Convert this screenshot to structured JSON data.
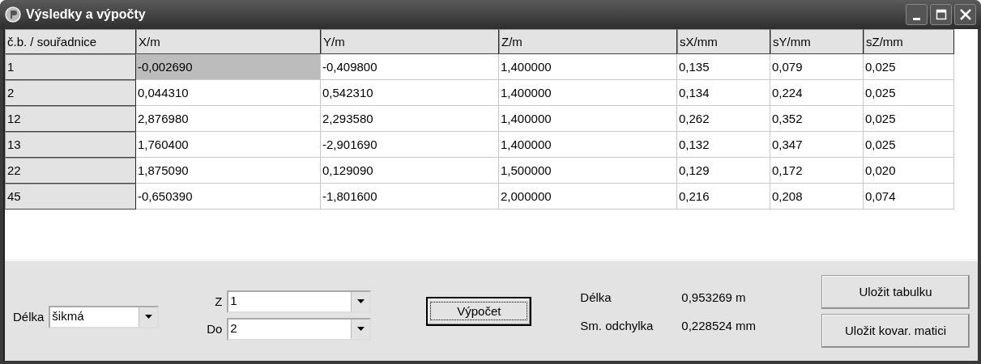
{
  "window": {
    "title": "Výsledky a výpočty"
  },
  "table": {
    "columns": [
      "č.b. / souřadnice",
      "X/m",
      "Y/m",
      "Z/m",
      "sX/mm",
      "sY/mm",
      "sZ/mm"
    ],
    "rows": [
      {
        "cells": [
          {
            "kind": "header",
            "text": "1",
            "selected": false
          },
          {
            "kind": "value",
            "text": "-0,002690",
            "selected": true
          },
          {
            "kind": "value",
            "text": "-0,409800",
            "selected": false
          },
          {
            "kind": "value",
            "text": "1,400000",
            "selected": false
          },
          {
            "kind": "value",
            "text": "0,135",
            "selected": false
          },
          {
            "kind": "value",
            "text": "0,079",
            "selected": false
          },
          {
            "kind": "value",
            "text": "0,025",
            "selected": false
          }
        ]
      },
      {
        "cells": [
          {
            "kind": "header",
            "text": "2",
            "selected": false
          },
          {
            "kind": "value",
            "text": "0,044310",
            "selected": false
          },
          {
            "kind": "value",
            "text": "0,542310",
            "selected": false
          },
          {
            "kind": "value",
            "text": "1,400000",
            "selected": false
          },
          {
            "kind": "value",
            "text": "0,134",
            "selected": false
          },
          {
            "kind": "value",
            "text": "0,224",
            "selected": false
          },
          {
            "kind": "value",
            "text": "0,025",
            "selected": false
          }
        ]
      },
      {
        "cells": [
          {
            "kind": "header",
            "text": "12",
            "selected": false
          },
          {
            "kind": "value",
            "text": "2,876980",
            "selected": false
          },
          {
            "kind": "value",
            "text": "2,293580",
            "selected": false
          },
          {
            "kind": "value",
            "text": "1,400000",
            "selected": false
          },
          {
            "kind": "value",
            "text": "0,262",
            "selected": false
          },
          {
            "kind": "value",
            "text": "0,352",
            "selected": false
          },
          {
            "kind": "value",
            "text": "0,025",
            "selected": false
          }
        ]
      },
      {
        "cells": [
          {
            "kind": "header",
            "text": "13",
            "selected": false
          },
          {
            "kind": "value",
            "text": "1,760400",
            "selected": false
          },
          {
            "kind": "value",
            "text": "-2,901690",
            "selected": false
          },
          {
            "kind": "value",
            "text": "1,400000",
            "selected": false
          },
          {
            "kind": "value",
            "text": "0,132",
            "selected": false
          },
          {
            "kind": "value",
            "text": "0,347",
            "selected": false
          },
          {
            "kind": "value",
            "text": "0,025",
            "selected": false
          }
        ]
      },
      {
        "cells": [
          {
            "kind": "header",
            "text": "22",
            "selected": false
          },
          {
            "kind": "value",
            "text": "1,875090",
            "selected": false
          },
          {
            "kind": "value",
            "text": "0,129090",
            "selected": false
          },
          {
            "kind": "value",
            "text": "1,500000",
            "selected": false
          },
          {
            "kind": "value",
            "text": "0,129",
            "selected": false
          },
          {
            "kind": "value",
            "text": "0,172",
            "selected": false
          },
          {
            "kind": "value",
            "text": "0,020",
            "selected": false
          }
        ]
      },
      {
        "cells": [
          {
            "kind": "header",
            "text": "45",
            "selected": false
          },
          {
            "kind": "value",
            "text": "-0,650390",
            "selected": false
          },
          {
            "kind": "value",
            "text": "-1,801600",
            "selected": false
          },
          {
            "kind": "value",
            "text": "2,000000",
            "selected": false
          },
          {
            "kind": "value",
            "text": "0,216",
            "selected": false
          },
          {
            "kind": "value",
            "text": "0,208",
            "selected": false
          },
          {
            "kind": "value",
            "text": "0,074",
            "selected": false
          }
        ]
      }
    ]
  },
  "controls": {
    "length_label": "Délka",
    "length_value": "šikmá",
    "from_label": "Z",
    "from_value": "1",
    "to_label": "Do",
    "to_value": "2",
    "compute_button": {
      "label": "Výpočet",
      "focused": true
    }
  },
  "results": [
    {
      "label": "Délka",
      "value": "0,953269 m"
    },
    {
      "label": "Sm. odchylka",
      "value": "0,228524 mm"
    }
  ],
  "buttons": [
    "Uložit tabulku",
    "Uložit kovar. matici"
  ]
}
